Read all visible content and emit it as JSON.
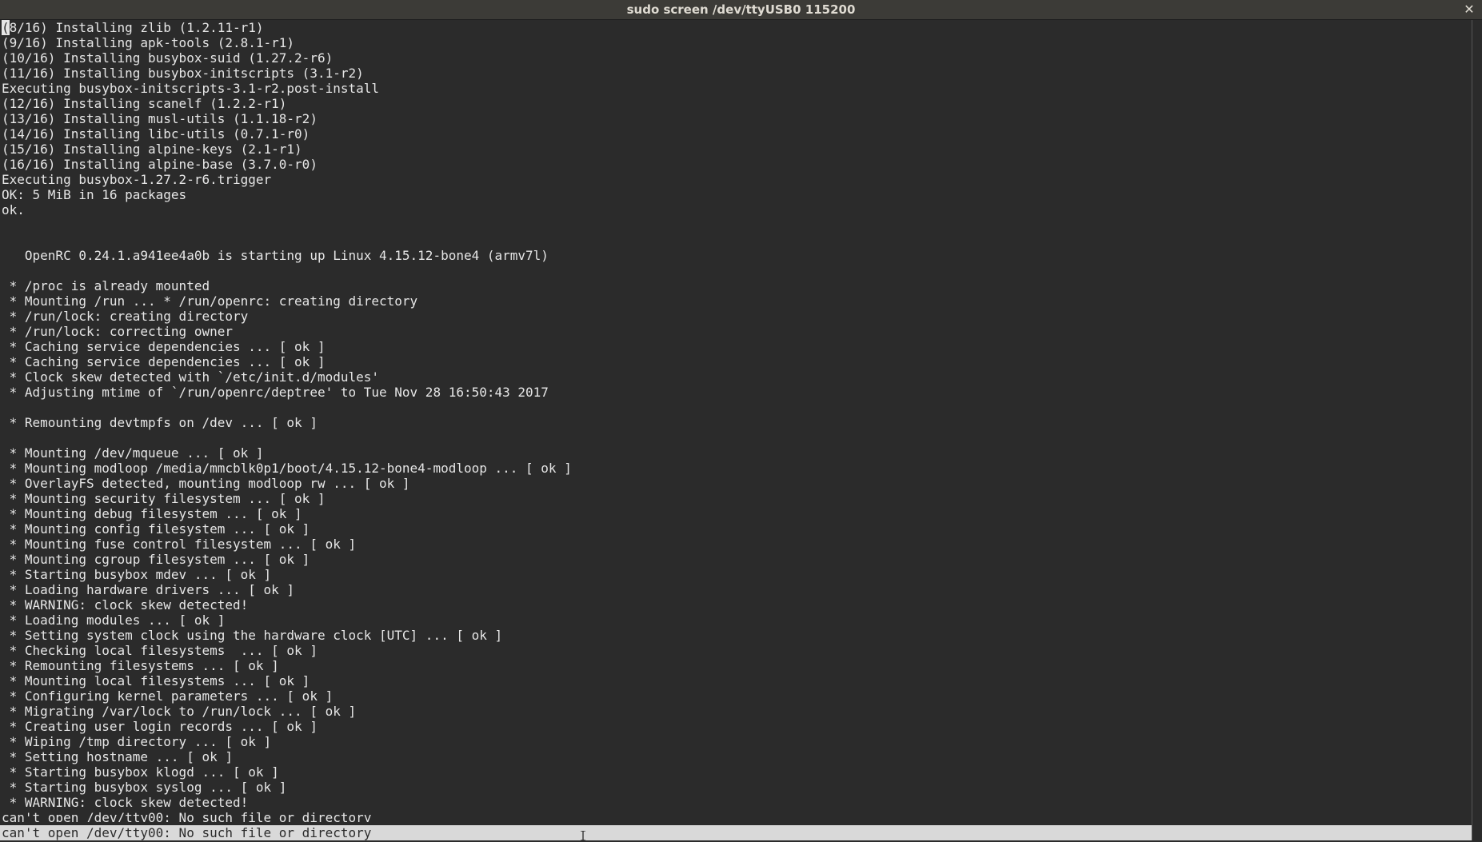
{
  "window": {
    "title": "sudo screen /dev/ttyUSB0 115200",
    "close_label": "✕"
  },
  "terminal": {
    "cursor_char": "(",
    "first_line_rest": "8/16) Installing zlib (1.2.11-r1)",
    "lines": [
      "(9/16) Installing apk-tools (2.8.1-r1)",
      "(10/16) Installing busybox-suid (1.27.2-r6)",
      "(11/16) Installing busybox-initscripts (3.1-r2)",
      "Executing busybox-initscripts-3.1-r2.post-install",
      "(12/16) Installing scanelf (1.2.2-r1)",
      "(13/16) Installing musl-utils (1.1.18-r2)",
      "(14/16) Installing libc-utils (0.7.1-r0)",
      "(15/16) Installing alpine-keys (2.1-r1)",
      "(16/16) Installing alpine-base (3.7.0-r0)",
      "Executing busybox-1.27.2-r6.trigger",
      "OK: 5 MiB in 16 packages",
      "ok.",
      "",
      "",
      "   OpenRC 0.24.1.a941ee4a0b is starting up Linux 4.15.12-bone4 (armv7l)",
      "",
      " * /proc is already mounted",
      " * Mounting /run ... * /run/openrc: creating directory",
      " * /run/lock: creating directory",
      " * /run/lock: correcting owner",
      " * Caching service dependencies ... [ ok ]",
      " * Caching service dependencies ... [ ok ]",
      " * Clock skew detected with `/etc/init.d/modules'",
      " * Adjusting mtime of `/run/openrc/deptree' to Tue Nov 28 16:50:43 2017",
      "",
      " * Remounting devtmpfs on /dev ... [ ok ]",
      "",
      " * Mounting /dev/mqueue ... [ ok ]",
      " * Mounting modloop /media/mmcblk0p1/boot/4.15.12-bone4-modloop ... [ ok ]",
      " * OverlayFS detected, mounting modloop rw ... [ ok ]",
      " * Mounting security filesystem ... [ ok ]",
      " * Mounting debug filesystem ... [ ok ]",
      " * Mounting config filesystem ... [ ok ]",
      " * Mounting fuse control filesystem ... [ ok ]",
      " * Mounting cgroup filesystem ... [ ok ]",
      " * Starting busybox mdev ... [ ok ]",
      " * Loading hardware drivers ... [ ok ]",
      " * WARNING: clock skew detected!",
      " * Loading modules ... [ ok ]",
      " * Setting system clock using the hardware clock [UTC] ... [ ok ]",
      " * Checking local filesystems  ... [ ok ]",
      " * Remounting filesystems ... [ ok ]",
      " * Mounting local filesystems ... [ ok ]",
      " * Configuring kernel parameters ... [ ok ]",
      " * Migrating /var/lock to /run/lock ... [ ok ]",
      " * Creating user login records ... [ ok ]",
      " * Wiping /tmp directory ... [ ok ]",
      " * Setting hostname ... [ ok ]",
      " * Starting busybox klogd ... [ ok ]",
      " * Starting busybox syslog ... [ ok ]",
      " * WARNING: clock skew detected!",
      "can't open /dev/tty00: No such file or directory"
    ]
  },
  "statusbar": {
    "message": "can't open /dev/tty00: No such file or directory"
  }
}
